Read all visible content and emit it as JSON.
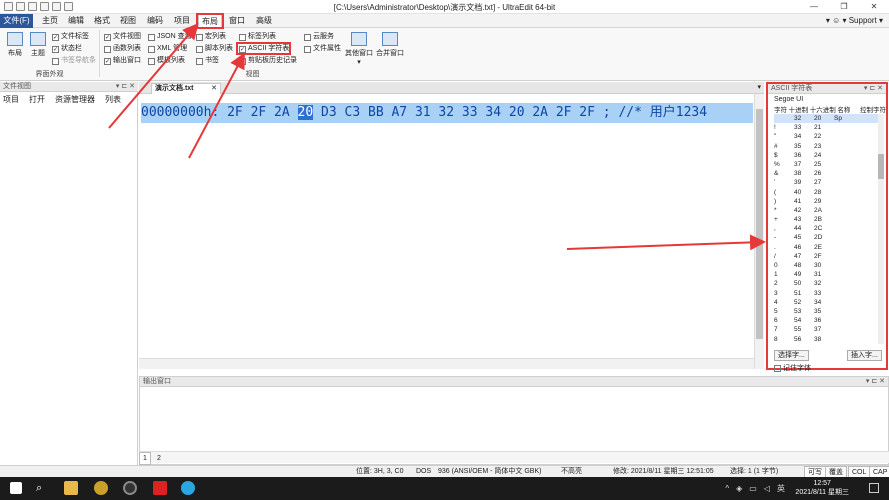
{
  "title": "[C:\\Users\\Administrator\\Desktop\\演示文档.txt] - UltraEdit 64-bit",
  "window": {
    "minimize": "—",
    "restore": "❐",
    "close": "✕"
  },
  "menu": {
    "file": "文件(F)",
    "items": [
      "主页",
      "编辑",
      "格式",
      "视图",
      "编码",
      "项目",
      "布局",
      "窗口",
      "高级"
    ],
    "active": "布局",
    "support": "Support"
  },
  "ribbon": {
    "big": [
      "布局",
      "主题"
    ],
    "group1_checks": [
      {
        "label": "文件标签",
        "checked": true
      },
      {
        "label": "状态栏",
        "checked": true
      },
      {
        "label": "书签导航条",
        "checked": false
      }
    ],
    "group1_label": "界面外观",
    "views_col1": [
      {
        "label": "文件视图",
        "checked": true
      },
      {
        "label": "函数列表",
        "checked": false
      },
      {
        "label": "输出窗口",
        "checked": true
      }
    ],
    "views_col2": [
      {
        "label": "JSON 查看",
        "checked": false
      },
      {
        "label": "XML 管理",
        "checked": false
      },
      {
        "label": "模板列表",
        "checked": false
      }
    ],
    "views_col3": [
      {
        "label": "宏列表",
        "checked": false
      },
      {
        "label": "脚本列表",
        "checked": false
      },
      {
        "label": "书签",
        "checked": false
      }
    ],
    "views_col4": [
      {
        "label": "标签列表",
        "checked": false
      },
      {
        "label": "ASCII 字符表",
        "checked": true
      },
      {
        "label": "剪贴板历史记录",
        "checked": false
      }
    ],
    "views_col5": [
      {
        "label": "云服务",
        "checked": false
      },
      {
        "label": "文件属性",
        "checked": false
      }
    ],
    "other_windows": "其他窗口",
    "merge_windows": "合并窗口",
    "group2_label": "视图"
  },
  "left_panel": {
    "title": "文件视图",
    "tabs": [
      "项目",
      "打开",
      "资源管理器",
      "列表"
    ]
  },
  "editor": {
    "tab": "演示文档.txt",
    "line_prefix": "00000000h: 2F 2F 2A ",
    "line_hl": "20",
    "line_rest": " D3 C3 BB A7 31 32 33 34 20 2A 2F 2F ; //* 用户1234"
  },
  "output": {
    "title": "输出窗口",
    "pages": [
      "1",
      "2"
    ]
  },
  "ascii": {
    "title": "ASCII 字符表",
    "font": "Segoe UI",
    "headers": [
      "字符",
      "十进制",
      "十六进制",
      "名称",
      "控制字符"
    ],
    "rows": [
      [
        " ",
        "32",
        "20",
        "Sp"
      ],
      [
        "!",
        "33",
        "21",
        ""
      ],
      [
        "\"",
        "34",
        "22",
        ""
      ],
      [
        "#",
        "35",
        "23",
        ""
      ],
      [
        "$",
        "36",
        "24",
        ""
      ],
      [
        "%",
        "37",
        "25",
        ""
      ],
      [
        "&",
        "38",
        "26",
        ""
      ],
      [
        "'",
        "39",
        "27",
        ""
      ],
      [
        "(",
        "40",
        "28",
        ""
      ],
      [
        ")",
        "41",
        "29",
        ""
      ],
      [
        "*",
        "42",
        "2A",
        ""
      ],
      [
        "+",
        "43",
        "2B",
        ""
      ],
      [
        ",",
        "44",
        "2C",
        ""
      ],
      [
        "-",
        "45",
        "2D",
        ""
      ],
      [
        ".",
        "46",
        "2E",
        ""
      ],
      [
        "/",
        "47",
        "2F",
        ""
      ],
      [
        "0",
        "48",
        "30",
        ""
      ],
      [
        "1",
        "49",
        "31",
        ""
      ],
      [
        "2",
        "50",
        "32",
        ""
      ],
      [
        "3",
        "51",
        "33",
        ""
      ],
      [
        "4",
        "52",
        "34",
        ""
      ],
      [
        "5",
        "53",
        "35",
        ""
      ],
      [
        "6",
        "54",
        "36",
        ""
      ],
      [
        "7",
        "55",
        "37",
        ""
      ],
      [
        "8",
        "56",
        "38",
        ""
      ]
    ],
    "choose_btn": "选择字...",
    "insert_btn": "插入字...",
    "remember": "记住字体"
  },
  "status": {
    "position": "位置: 3H, 3, C0",
    "dos": "DOS",
    "encoding": "936  (ANSI/OEM - 简体中文 GBK)",
    "highlight": "不高亮",
    "modified": "修改: 2021/8/11 星期三 12:51:05",
    "selection": "选择: 1 (1 字节)",
    "writable": "可写",
    "overwrite": "覆盖",
    "col": "COL",
    "caps": "CAP"
  },
  "taskbar": {
    "time": "12:57",
    "date": "2021/8/11 星期三",
    "ime": "英"
  },
  "colors": {
    "accent": "#2b579a",
    "highlight": "#a9d1f6",
    "annotation": "#e63838"
  }
}
